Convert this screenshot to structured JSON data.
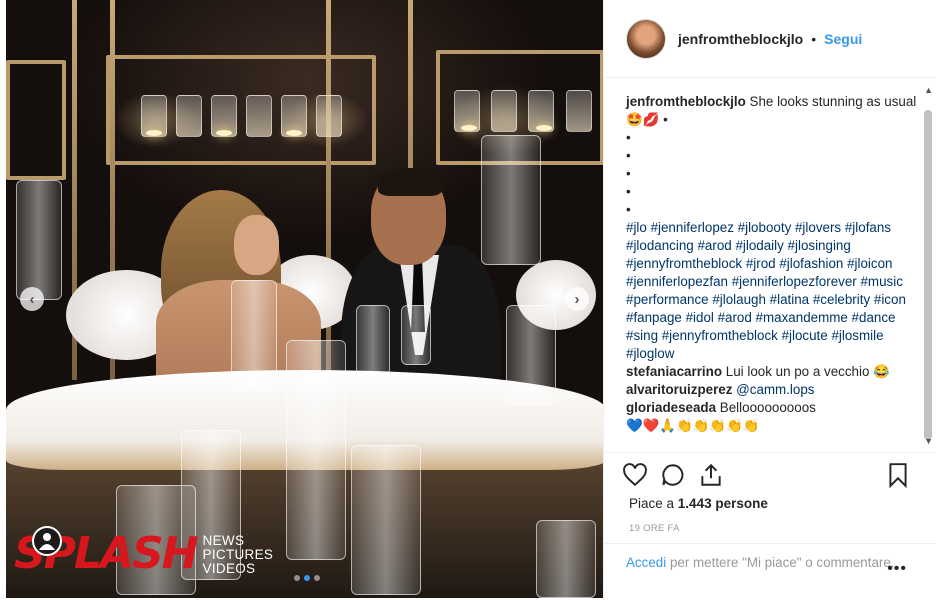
{
  "post": {
    "username": "jenfromtheblockjlo",
    "separator": "•",
    "follow_label": "Segui",
    "avatar_icon": "profile-avatar"
  },
  "caption": {
    "username": "jenfromtheblockjlo",
    "text": "She looks stunning as usual 🤩💋 •",
    "bullets": [
      "•",
      "•",
      "•",
      "•",
      "•"
    ],
    "hashtags": "#jlo #jenniferlopez #jlobooty #jlovers #jlofans #jlodancing #arod #jlodaily #jlosinging #jennyfromtheblock #jrod #jlofashion #jloicon #jenniferlopezfan #jenniferlopezforever #music #performance #jlolaugh #latina #celebrity #icon #fanpage #idol #arod #maxandemme #dance #sing #jennyfromtheblock #jlocute #jlosmile #jloglow"
  },
  "comments": [
    {
      "user": "stefaniacarrino",
      "text": "Lui look un po a vecchio 😂",
      "mention": ""
    },
    {
      "user": "alvaritoruizperez",
      "text": "",
      "mention": "@camm.lops"
    },
    {
      "user": "gloriadeseada",
      "text": "Bellooooooooos",
      "mention": ""
    },
    {
      "user": "",
      "text": "💙❤️🙏👏👏👏👏👏",
      "mention": ""
    }
  ],
  "likes": {
    "prefix": "Piace a",
    "count": "1.443",
    "suffix": "persone"
  },
  "time": "19 ORE FA",
  "login": {
    "link": "Accedi",
    "text": "per mettere \"Mi piace\" o commentare."
  },
  "more_label": "•••",
  "watermark": {
    "brand": "SPLASH",
    "lines": [
      "NEWS",
      "PICTURES",
      "VIDEOS"
    ]
  },
  "carousel": {
    "prev": "‹",
    "next": "›",
    "slide_count": 3,
    "active_slide": 1
  },
  "colors": {
    "link": "#3897f0",
    "hashtag": "#003569",
    "watermark_red": "#d6171e"
  }
}
